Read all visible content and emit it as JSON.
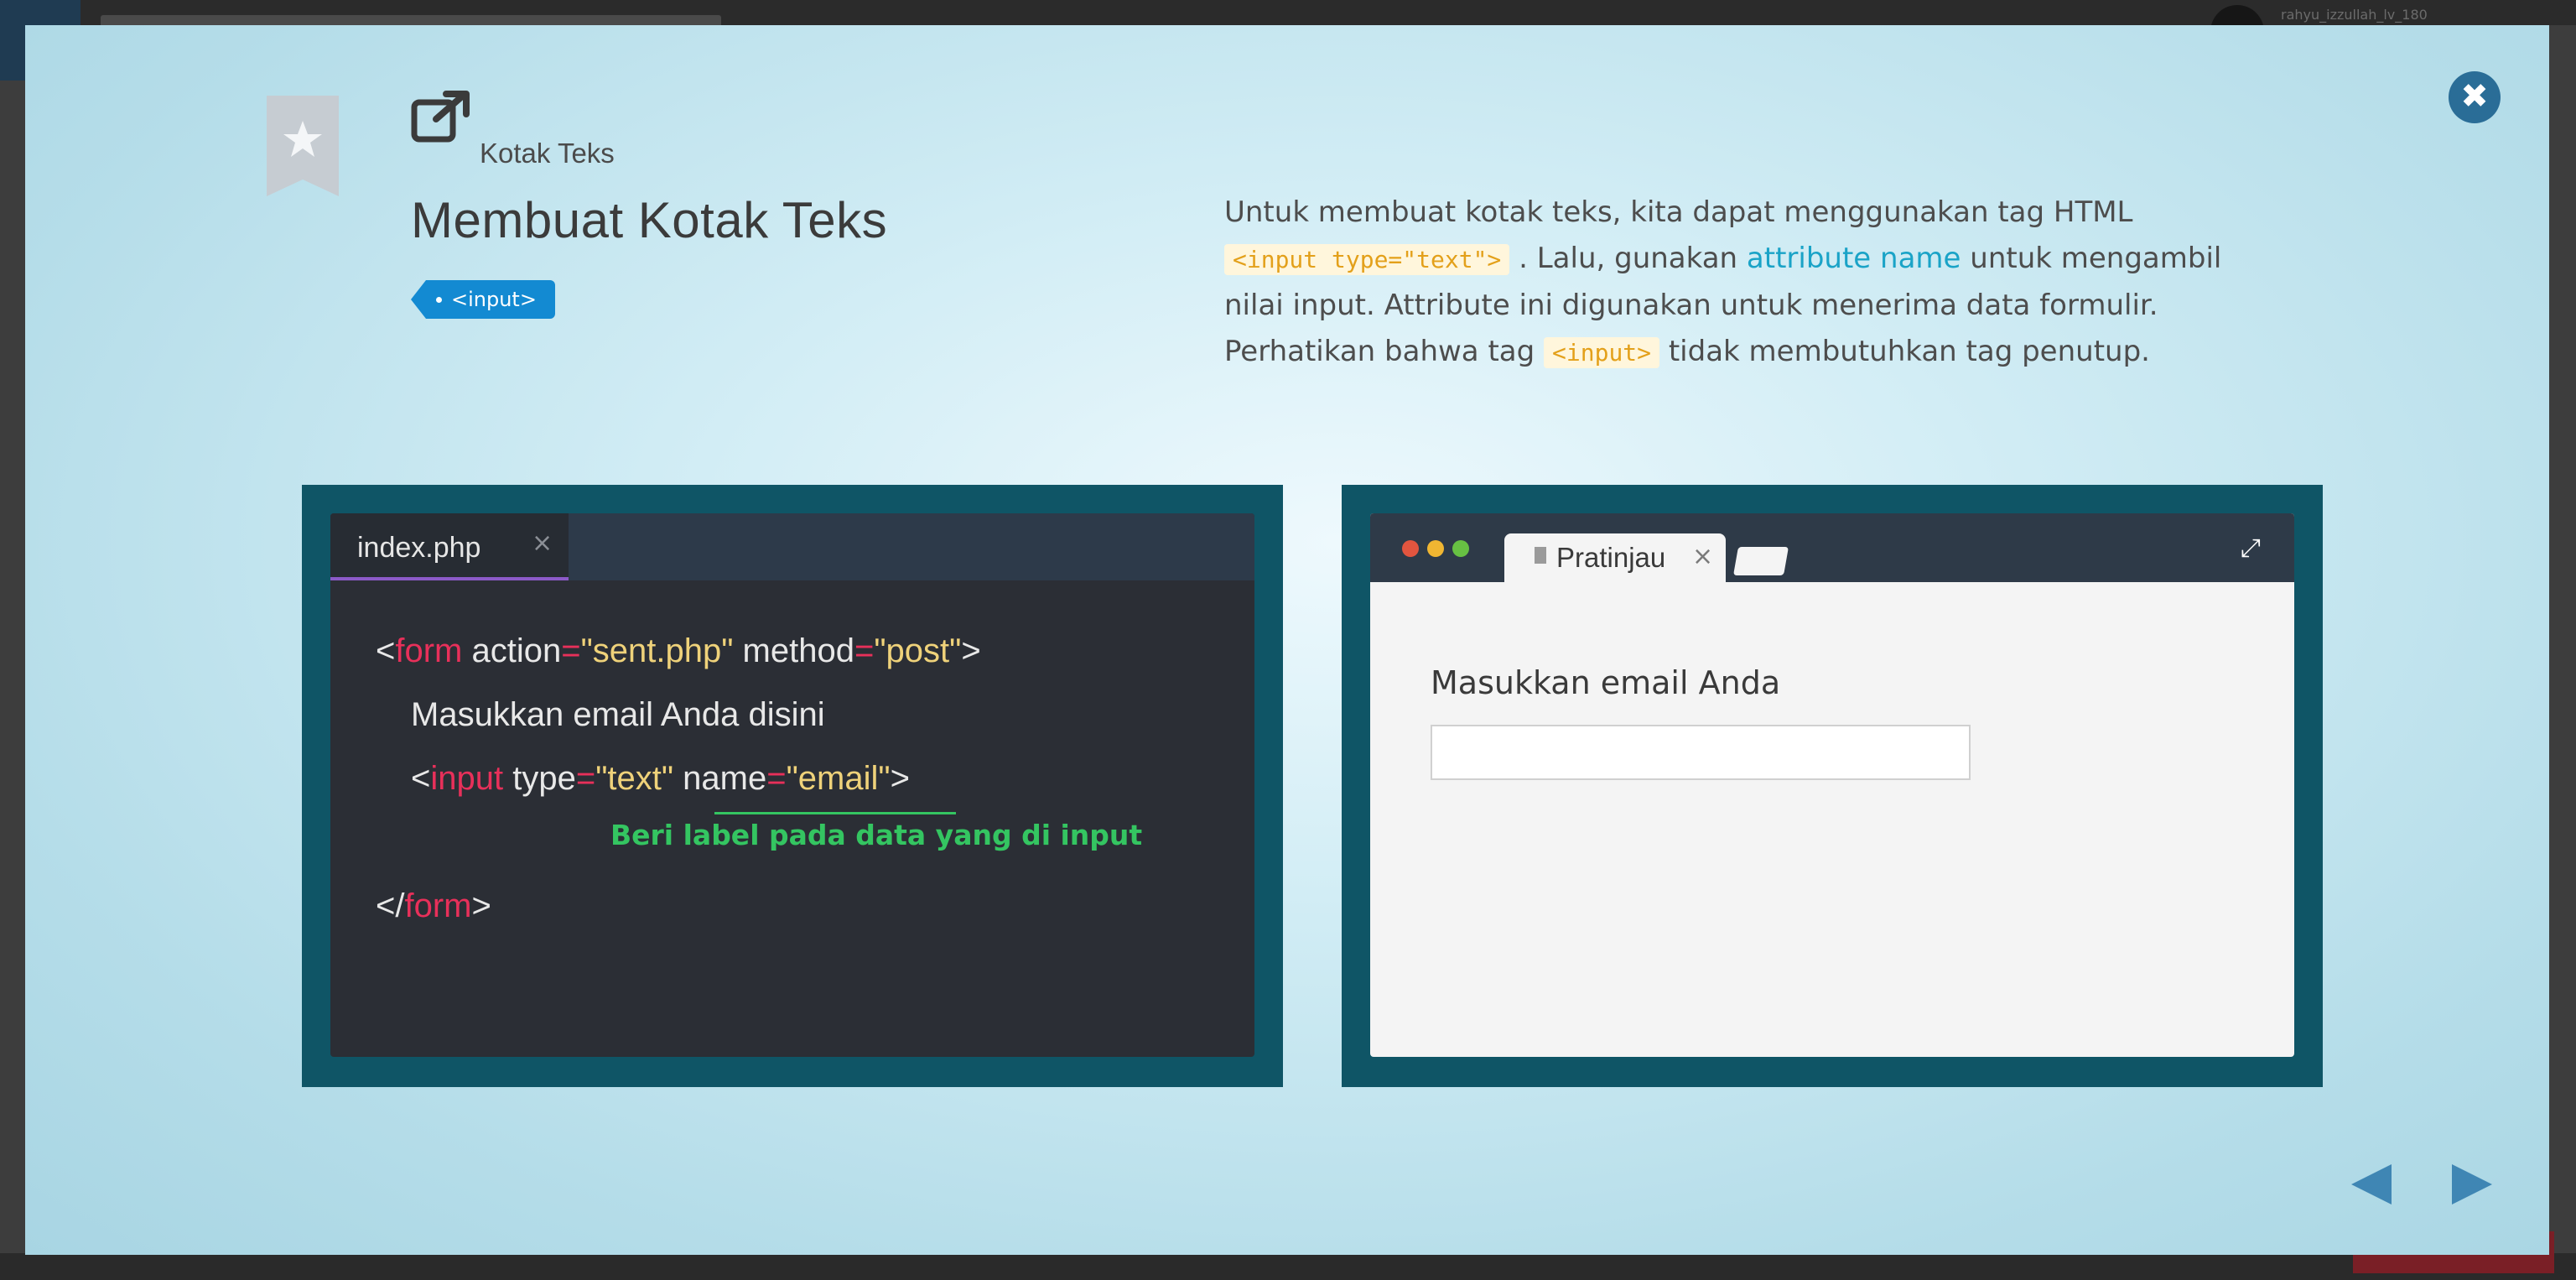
{
  "background": {
    "username": "rahyu_izzullah_lv_180"
  },
  "modal": {
    "breadcrumb": "Kotak Teks",
    "title": "Membuat Kotak Teks",
    "tag": "<input>",
    "description": {
      "p1": "Untuk membuat kotak teks, kita dapat menggunakan tag HTML",
      "code1": "<input type=\"text\">",
      "p2": ". Lalu, gunakan",
      "link": "attribute name",
      "p3": "untuk mengambil nilai input. Attribute ini digunakan untuk menerima data formulir. Perhatikan bahwa tag",
      "code2": "<input>",
      "p4": "tidak membutuhkan tag penutup."
    },
    "editor": {
      "filename": "index.php",
      "close": "×",
      "line1": {
        "open": "<",
        "tag": "form",
        "a1": " action",
        "eq1": "=",
        "v1": "\"sent.php\"",
        "a2": " method",
        "eq2": "=",
        "v2": "\"post\"",
        "close": ">"
      },
      "line2": "Masukkan email Anda disini",
      "line3": {
        "open": "<",
        "tag": "input",
        "a1": " type",
        "eq1": "=",
        "v1": "\"text\"",
        "a2": " name",
        "eq2": "=",
        "v2": "\"email\"",
        "close": ">"
      },
      "note": "Beri label pada data yang di input",
      "line4": {
        "open": "</",
        "tag": "form",
        "close": ">"
      }
    },
    "preview": {
      "tab_label": "Pratinjau",
      "tab_close": "×",
      "expand": "⤢",
      "label": "Masukkan email Anda",
      "input_value": ""
    },
    "close_icon": "✖",
    "colors": {
      "accent": "#138ad2",
      "panel": "#0f5566",
      "keyword": "#e8305a",
      "string": "#efd27a",
      "note": "#34c561"
    }
  }
}
